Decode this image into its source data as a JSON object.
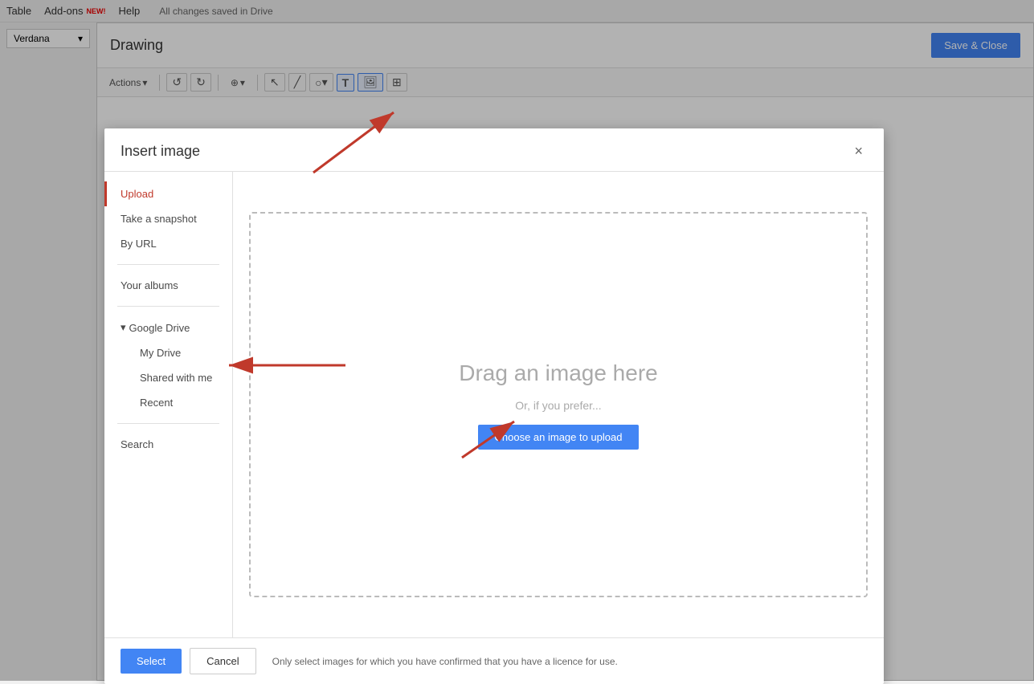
{
  "menubar": {
    "table_label": "Table",
    "addons_label": "Add-ons",
    "new_tag": "NEW!",
    "help_label": "Help",
    "allchanges_label": "All changes saved in Drive"
  },
  "font_selector": {
    "font": "Verdana",
    "dropdown_icon": "▾"
  },
  "drawing": {
    "title": "Drawing",
    "save_close_label": "Save & Close"
  },
  "toolbar": {
    "actions_label": "Actions",
    "dropdown_icon": "▾",
    "undo_icon": "↺",
    "redo_icon": "↻",
    "zoom_label": "⊕",
    "zoom_dropdown": "▾",
    "select_icon": "↖",
    "line_icon": "╱",
    "shape_icon": "○",
    "shape_dropdown": "▾",
    "text_icon": "T",
    "image_icon": "🖼",
    "table_icon": "⊞"
  },
  "dialog": {
    "title": "Insert image",
    "close_icon": "×",
    "sidebar": {
      "upload_label": "Upload",
      "snapshot_label": "Take a snapshot",
      "by_url_label": "By URL",
      "your_albums_label": "Your albums",
      "google_drive_label": "Google Drive",
      "google_drive_icon": "▾",
      "my_drive_label": "My Drive",
      "shared_label": "Shared with me",
      "recent_label": "Recent",
      "search_label": "Search"
    },
    "dropzone": {
      "title": "Drag an image here",
      "subtitle": "Or, if you prefer...",
      "choose_label": "Choose an image to upload"
    },
    "footer": {
      "select_label": "Select",
      "cancel_label": "Cancel",
      "license_text": "Only select images for which you have confirmed that you have a licence for use."
    }
  }
}
